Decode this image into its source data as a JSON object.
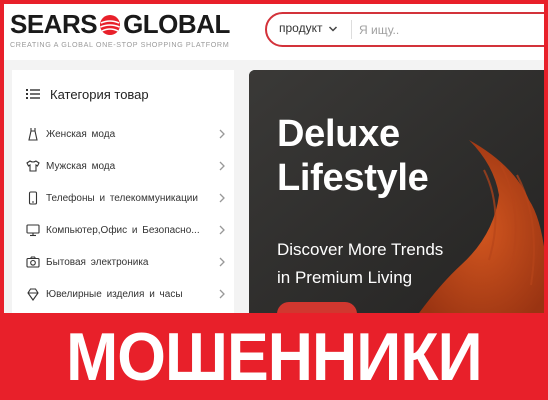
{
  "header": {
    "logo_left": "SEARS",
    "logo_right": "GLOBAL",
    "tagline": "CREATING A GLOBAL ONE-STOP SHOPPING PLATFORM",
    "search": {
      "category": "продукт",
      "placeholder": "Я ищу..",
      "value": ""
    }
  },
  "sidebar": {
    "title": "Категория товар",
    "items": [
      {
        "label": "Женская мода",
        "icon": "dress-icon"
      },
      {
        "label": "Мужская мода",
        "icon": "shirt-icon"
      },
      {
        "label": "Телефоны и телекоммуникации",
        "icon": "phone-icon"
      },
      {
        "label": "Компьютер,Офис и Безопасно...",
        "icon": "computer-icon"
      },
      {
        "label": "Бытовая электроника",
        "icon": "camera-icon"
      },
      {
        "label": "Ювелирные изделия и часы",
        "icon": "jewelry-icon"
      }
    ]
  },
  "banner": {
    "title_line1": "Deluxe",
    "title_line2": "Lifestyle",
    "subtitle_line1": "Discover More Trends",
    "subtitle_line2": "in Premium Living"
  },
  "overlay": {
    "text": "МОШЕННИКИ"
  },
  "colors": {
    "brand_red": "#e8202a",
    "search_border": "#d3323a",
    "banner_dark": "#2c2b2a",
    "banner_orange": "#c4491d"
  }
}
